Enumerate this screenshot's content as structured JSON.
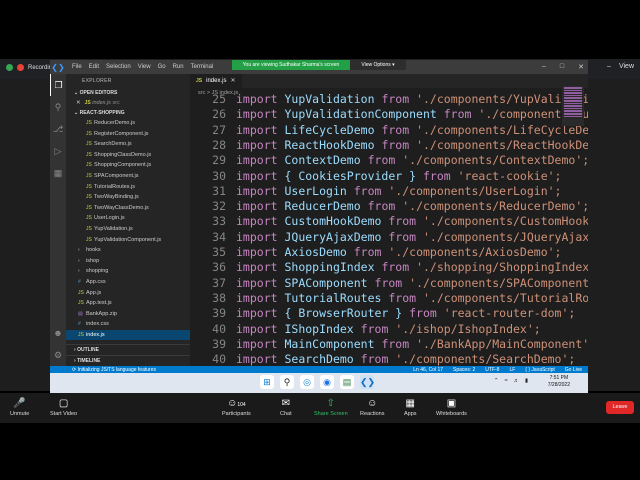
{
  "browser": {
    "tab_label": "Recordin",
    "right_label": "View"
  },
  "zoom_banner": {
    "message": "You are viewing Sudhakar Sharma's screen",
    "view_options": "View Options ▾"
  },
  "vscode": {
    "menu": [
      "File",
      "Edit",
      "Selection",
      "View",
      "Go",
      "Run",
      "Terminal"
    ],
    "explorer_header": "EXPLORER",
    "open_editors_label": "OPEN EDITORS",
    "open_editor_file": "index.js",
    "open_editor_path": "src",
    "project_label": "REACT-SHOPPING",
    "files": [
      {
        "name": "ReducerDemo.js",
        "type": "js",
        "indent": 2
      },
      {
        "name": "RegisterComponent.js",
        "type": "js",
        "indent": 2
      },
      {
        "name": "SearchDemo.js",
        "type": "js",
        "indent": 2
      },
      {
        "name": "ShoppingClassDemo.js",
        "type": "js",
        "indent": 2
      },
      {
        "name": "ShoppingComponent.js",
        "type": "js",
        "indent": 2
      },
      {
        "name": "SPAComponent.js",
        "type": "js",
        "indent": 2
      },
      {
        "name": "TutorialRoutes.js",
        "type": "js",
        "indent": 2
      },
      {
        "name": "TwoWayBinding.js",
        "type": "js",
        "indent": 2
      },
      {
        "name": "TwoWayClassDemo.js",
        "type": "js",
        "indent": 2
      },
      {
        "name": "UserLogin.js",
        "type": "js",
        "indent": 2
      },
      {
        "name": "YupValidation.js",
        "type": "js",
        "indent": 2
      },
      {
        "name": "YupValidationComponent.js",
        "type": "js",
        "indent": 2
      },
      {
        "name": "hooks",
        "type": "folder",
        "indent": 1
      },
      {
        "name": "ishop",
        "type": "folder",
        "indent": 1
      },
      {
        "name": "shopping",
        "type": "folder",
        "indent": 1
      },
      {
        "name": "App.css",
        "type": "css",
        "indent": 1
      },
      {
        "name": "App.js",
        "type": "js",
        "indent": 1
      },
      {
        "name": "App.test.js",
        "type": "js",
        "indent": 1
      },
      {
        "name": "BankApp.zip",
        "type": "zip",
        "indent": 1
      },
      {
        "name": "index.css",
        "type": "css",
        "indent": 1
      },
      {
        "name": "index.js",
        "type": "js",
        "indent": 1,
        "selected": true
      }
    ],
    "outline_label": "OUTLINE",
    "timeline_label": "TIMELINE",
    "tab_label": "index.js",
    "breadcrumb": "src > JS index.js",
    "code_lines": [
      {
        "n": "25",
        "ident": "YupValidation",
        "path": "'./components/YupValidatio"
      },
      {
        "n": "26",
        "ident": "YupValidationComponent",
        "path": "'./components/Yup"
      },
      {
        "n": "27",
        "ident": "LifeCycleDemo",
        "path": "'./components/LifeCycleDem"
      },
      {
        "n": "28",
        "ident": "ReactHookDemo",
        "path": "'./components/ReactHookDem"
      },
      {
        "n": "29",
        "ident": "ContextDemo",
        "path": "'./components/ContextDemo';"
      },
      {
        "n": "30",
        "ident": "{ CookiesProvider }",
        "path": "'react-cookie';"
      },
      {
        "n": "31",
        "ident": "UserLogin",
        "path": "'./components/UserLogin';"
      },
      {
        "n": "32",
        "ident": "ReducerDemo",
        "path": "'./components/ReducerDemo';"
      },
      {
        "n": "33",
        "ident": "CustomHookDemo",
        "path": "'./components/CustomHookD"
      },
      {
        "n": "34",
        "ident": "JQueryAjaxDemo",
        "path": "'./components/JQueryAjaxD"
      },
      {
        "n": "35",
        "ident": "AxiosDemo",
        "path": "'./components/AxiosDemo';"
      },
      {
        "n": "36",
        "ident": "ShoppingIndex",
        "path": "'./shopping/ShoppingIndex"
      },
      {
        "n": "37",
        "ident": "SPAComponent",
        "path": "'./components/SPAComponent"
      },
      {
        "n": "38",
        "ident": "TutorialRoutes",
        "path": "'./components/TutorialRou"
      },
      {
        "n": "39",
        "ident": "{ BrowserRouter }",
        "path": "'react-router-dom';"
      },
      {
        "n": "40",
        "ident": "IShopIndex",
        "path": "'./ishop/IshopIndex';"
      },
      {
        "n": "39",
        "ident": "MainComponent",
        "path": "'./BankApp/MainComponent';"
      },
      {
        "n": "40",
        "ident": "SearchDemo",
        "path": "'./components/SearchDemo';"
      }
    ],
    "keyword_import": "import",
    "keyword_from": "from",
    "status_left": "Initializing JS/TS language features",
    "status_right": [
      "Ln 46, Col 17",
      "Spaces: 2",
      "UTF-8",
      "LF",
      "{ } JavaScript",
      "Go Live"
    ]
  },
  "taskbar": {
    "time": "7:51 PM",
    "date": "7/28/2022"
  },
  "zoom_controls": {
    "unmute": "Unmute",
    "start_video": "Start Video",
    "participants": "Participants",
    "participants_count": "104",
    "chat": "Chat",
    "share_screen": "Share Screen",
    "reactions": "Reactions",
    "apps": "Apps",
    "whiteboards": "Whiteboards",
    "leave": "Leave"
  }
}
